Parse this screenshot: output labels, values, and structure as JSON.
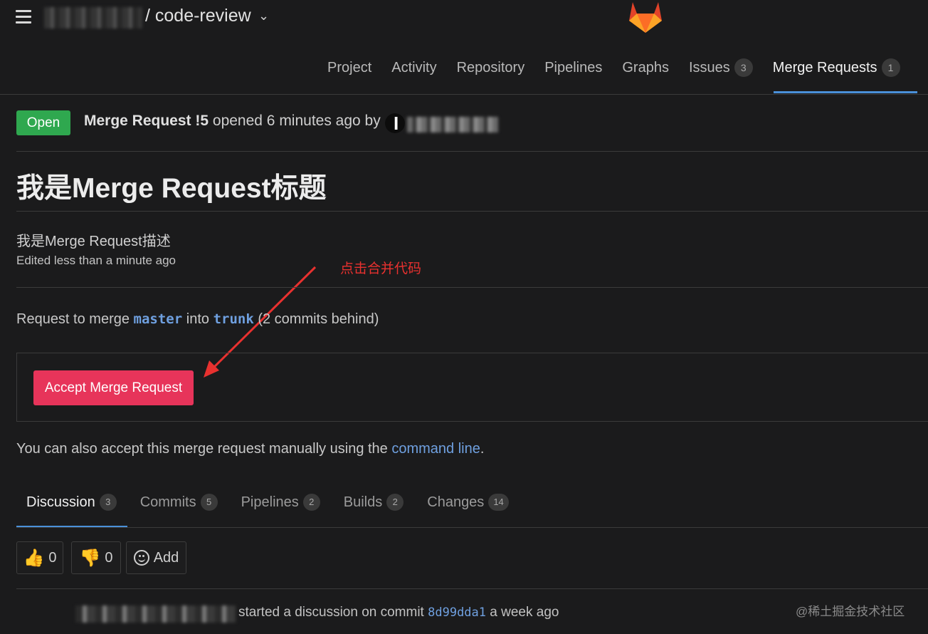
{
  "header": {
    "project_name": "/ code-review",
    "chevron": "⌄",
    "icons": [
      "menu-icon",
      "gitlab-logo"
    ]
  },
  "nav": [
    {
      "label": "Project"
    },
    {
      "label": "Activity"
    },
    {
      "label": "Repository"
    },
    {
      "label": "Pipelines"
    },
    {
      "label": "Graphs"
    },
    {
      "label": "Issues",
      "count": "3"
    },
    {
      "label": "Merge Requests",
      "count": "1",
      "active": true
    }
  ],
  "mr": {
    "status": "Open",
    "ref": "Merge Request !5",
    "opened_text": "opened 6 minutes ago by",
    "title": "我是Merge Request标题",
    "description": "我是Merge Request描述",
    "edited": "Edited less than a minute ago",
    "merge_prefix": "Request to merge",
    "source_branch": "master",
    "into": "into",
    "target_branch": "trunk",
    "behind": "(2 commits behind)",
    "accept_label": "Accept Merge Request",
    "manual_prefix": "You can also accept this merge request manually using the",
    "manual_link": "command line",
    "manual_suffix": "."
  },
  "annotation": "点击合并代码",
  "tabs": [
    {
      "label": "Discussion",
      "count": "3",
      "active": true
    },
    {
      "label": "Commits",
      "count": "5"
    },
    {
      "label": "Pipelines",
      "count": "2"
    },
    {
      "label": "Builds",
      "count": "2"
    },
    {
      "label": "Changes",
      "count": "14"
    }
  ],
  "awards": {
    "thumbs_up": "0",
    "thumbs_down": "0",
    "add_label": "Add"
  },
  "discussion": {
    "text": "started a discussion on commit",
    "commit": "8d99dda1",
    "time": "a week ago"
  },
  "watermark": "@稀土掘金技术社区",
  "colors": {
    "background": "#1b1b1c",
    "open_badge": "#2fa84f",
    "accept_button": "#e7345a",
    "link": "#6fa0e0",
    "annotation": "#e8312f",
    "active_underline": "#4a90d9"
  }
}
